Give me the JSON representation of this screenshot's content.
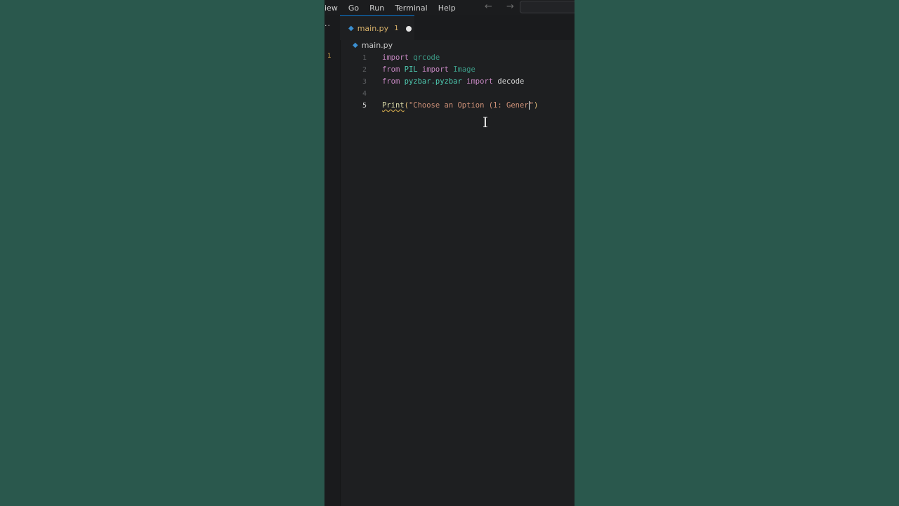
{
  "menu": [
    "iew",
    "Go",
    "Run",
    "Terminal",
    "Help"
  ],
  "nav_arrows": "← →",
  "tab": {
    "filename": "main.py",
    "problems": "1"
  },
  "breadcrumb": "main.py",
  "activity_badge": "1",
  "code_lines": [
    {
      "n": "1",
      "tokens": [
        [
          "kw",
          "import"
        ],
        [
          "plain",
          " "
        ],
        [
          "mod-dim",
          "qrcode"
        ]
      ]
    },
    {
      "n": "2",
      "tokens": [
        [
          "kw",
          "from"
        ],
        [
          "plain",
          " "
        ],
        [
          "mod",
          "PIL"
        ],
        [
          "plain",
          " "
        ],
        [
          "kw",
          "import"
        ],
        [
          "plain",
          " "
        ],
        [
          "mod-dim",
          "Image"
        ]
      ]
    },
    {
      "n": "3",
      "tokens": [
        [
          "kw",
          "from"
        ],
        [
          "plain",
          " "
        ],
        [
          "mod",
          "pyzbar.pyzbar"
        ],
        [
          "plain",
          " "
        ],
        [
          "kw",
          "import"
        ],
        [
          "plain",
          " "
        ],
        [
          "plain",
          "decode"
        ]
      ]
    },
    {
      "n": "4",
      "tokens": []
    },
    {
      "n": "5",
      "active": true,
      "tokens": [
        [
          "fn",
          "Print"
        ],
        [
          "paren",
          "("
        ],
        [
          "str",
          "\"Choose an Option (1: Gener"
        ],
        [
          "cursor",
          ""
        ],
        [
          "str",
          "\""
        ],
        [
          "paren",
          ")"
        ]
      ]
    }
  ],
  "colors": {
    "background": "#2a584d",
    "editor": "#1e1f21",
    "keyword": "#c586c0",
    "module": "#4ec9b0",
    "string": "#ce9178",
    "function": "#dcdcaa",
    "accent": "#0a7ad6"
  }
}
